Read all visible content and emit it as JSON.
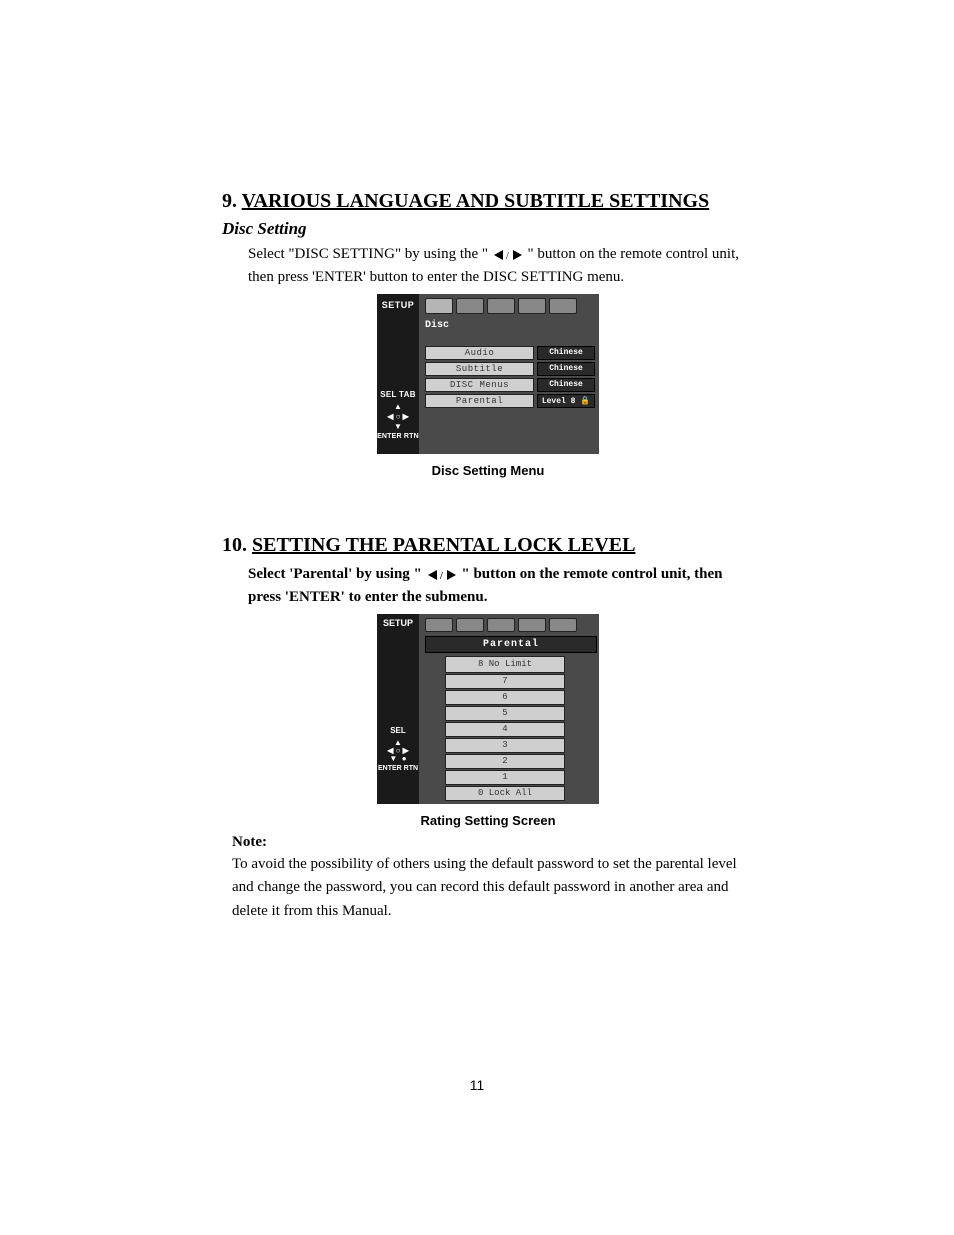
{
  "section9": {
    "number": "9.",
    "title": "VARIOUS LANGUAGE AND SUBTITLE SETTINGS",
    "subhead": "Disc Setting",
    "para_a": "Select \"DISC SETTING\" by using the \" ",
    "para_b": " \" button on the remote control unit, then press 'ENTER' button to enter the DISC SETTING menu.",
    "caption": "Disc Setting Menu",
    "osd": {
      "setup": "SETUP",
      "seltab": "SEL TAB",
      "enter_rtn": "ENTER RTN",
      "disc": "Disc",
      "rows": [
        {
          "name": "Audio",
          "value": "Chinese"
        },
        {
          "name": "Subtitle",
          "value": "Chinese"
        },
        {
          "name": "DISC Menus",
          "value": "Chinese"
        },
        {
          "name": "Parental",
          "value": "Level 8 🔒"
        }
      ]
    }
  },
  "section10": {
    "number": "10.",
    "title": "SETTING THE PARENTAL LOCK LEVEL",
    "para_a": "Select 'Parental' by using \"",
    "para_b": "\" button on the remote control unit, then press 'ENTER' to enter the submenu.",
    "caption": "Rating Setting Screen",
    "osd": {
      "setup": "SETUP",
      "sel": "SEL",
      "enter_rtn": "ENTER RTN",
      "title": "Parental",
      "levels": [
        "8 No Limit",
        "7",
        "6",
        "5",
        "4",
        "3",
        "2",
        "1",
        "0 Lock All"
      ]
    },
    "note_label": "Note:",
    "note_text": "To avoid the possibility of others using the default password to set the parental level and change the password, you can record this default password in another area and delete it from this Manual."
  },
  "page_number": "11"
}
